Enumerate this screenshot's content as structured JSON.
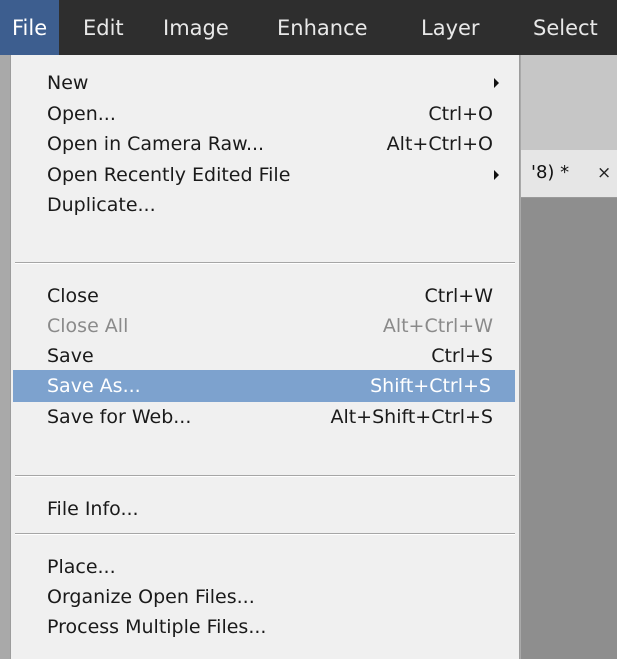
{
  "menubar": {
    "items": [
      "File",
      "Edit",
      "Image",
      "Enhance",
      "Layer",
      "Select"
    ]
  },
  "document_tab": {
    "label": "'8) *",
    "close": "×"
  },
  "file_menu": {
    "new": {
      "label": "New",
      "has_submenu": true
    },
    "open": {
      "label": "Open...",
      "shortcut": "Ctrl+O"
    },
    "open_camera_raw": {
      "label": "Open in Camera Raw...",
      "shortcut": "Alt+Ctrl+O"
    },
    "open_recent": {
      "label": "Open Recently Edited File",
      "has_submenu": true
    },
    "duplicate": {
      "label": "Duplicate..."
    },
    "close": {
      "label": "Close",
      "shortcut": "Ctrl+W"
    },
    "close_all": {
      "label": "Close All",
      "shortcut": "Alt+Ctrl+W",
      "disabled": true
    },
    "save": {
      "label": "Save",
      "shortcut": "Ctrl+S"
    },
    "save_as": {
      "label": "Save As...",
      "shortcut": "Shift+Ctrl+S",
      "highlighted": true
    },
    "save_for_web": {
      "label": "Save for Web...",
      "shortcut": "Alt+Shift+Ctrl+S"
    },
    "file_info": {
      "label": "File Info..."
    },
    "place": {
      "label": "Place..."
    },
    "organize": {
      "label": "Organize Open Files..."
    },
    "process_multiple": {
      "label": "Process Multiple Files..."
    }
  },
  "colors": {
    "menubar_bg": "#2e2e2e",
    "active_menu_bg": "#3d5e8f",
    "menu_bg": "#f0f0f0",
    "highlight_bg": "#7da2ce",
    "disabled_text": "#8a8a8a"
  }
}
